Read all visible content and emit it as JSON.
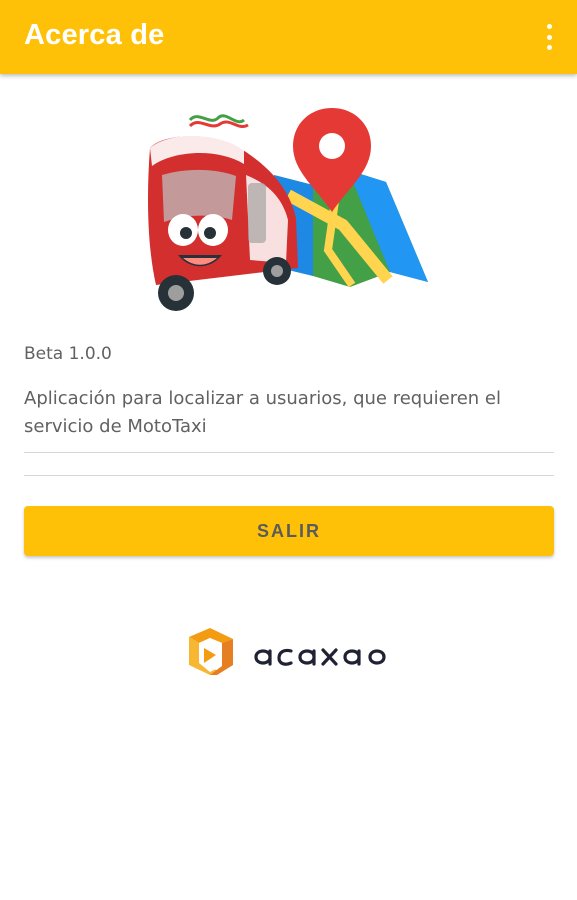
{
  "appbar": {
    "title": "Acerca de",
    "menu_icon": "more-vert-icon"
  },
  "hero": {
    "illustration": "mototaxi-with-map-pin"
  },
  "about": {
    "version": "Beta 1.0.0",
    "description": "Aplicación para localizar a usuarios, que requieren el servicio de MotoTaxi"
  },
  "actions": {
    "exit_label": "SALIR"
  },
  "brand": {
    "name": "acaxao"
  },
  "colors": {
    "primary": "#FFC107",
    "text_secondary": "#616161",
    "divider": "#d6d6d6",
    "logo_orange": "#F39C12",
    "logo_text": "#1f2233"
  }
}
